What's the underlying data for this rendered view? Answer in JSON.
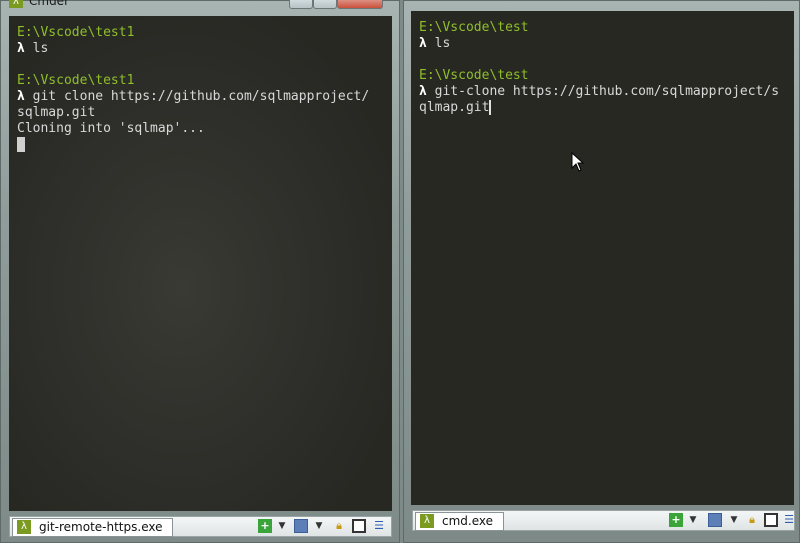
{
  "left_window": {
    "title": "Cmder",
    "title_icon": "λ",
    "lines": [
      {
        "kind": "path",
        "text": "E:\\Vscode\\test1"
      },
      {
        "kind": "prompt",
        "prompt": "λ",
        "text": " ls"
      },
      {
        "kind": "blank",
        "text": ""
      },
      {
        "kind": "path",
        "text": "E:\\Vscode\\test1"
      },
      {
        "kind": "prompt",
        "prompt": "λ",
        "text": " git clone https://github.com/sqlmapproject/"
      },
      {
        "kind": "text",
        "text": "sqlmap.git"
      },
      {
        "kind": "text",
        "text": "Cloning into 'sqlmap'..."
      }
    ],
    "status_tab": "git-remote-https.exe",
    "tab_icon": "λ"
  },
  "right_window": {
    "lines": [
      {
        "kind": "path",
        "text": "E:\\Vscode\\test"
      },
      {
        "kind": "prompt",
        "prompt": "λ",
        "text": " ls"
      },
      {
        "kind": "blank",
        "text": ""
      },
      {
        "kind": "path",
        "text": "E:\\Vscode\\test"
      },
      {
        "kind": "prompt",
        "prompt": "λ",
        "text": " git-clone https://github.com/sqlmapproject/s"
      },
      {
        "kind": "text",
        "text": "qlmap.git"
      }
    ],
    "status_tab": "cmd.exe",
    "tab_icon": "λ"
  },
  "status_icons": [
    "plus-icon",
    "dropdown-icon",
    "split-icon",
    "dropdown-icon",
    "lock-icon",
    "window-icon",
    "menu-icon"
  ],
  "colors": {
    "path": "#8fbf2a",
    "console_bg": "#272822",
    "text": "#d8d8d8"
  }
}
